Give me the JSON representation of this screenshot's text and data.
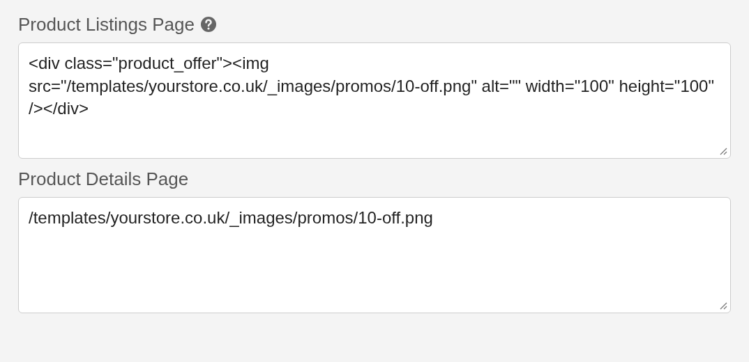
{
  "fields": [
    {
      "label": "Product Listings Page",
      "help": true,
      "value": "<div class=\"product_offer\"><img src=\"/templates/yourstore.co.uk/_images/promos/10-off.png\" alt=\"\" width=\"100\" height=\"100\" /></div>"
    },
    {
      "label": "Product Details Page",
      "help": false,
      "value": "/templates/yourstore.co.uk/_images/promos/10-off.png"
    }
  ]
}
